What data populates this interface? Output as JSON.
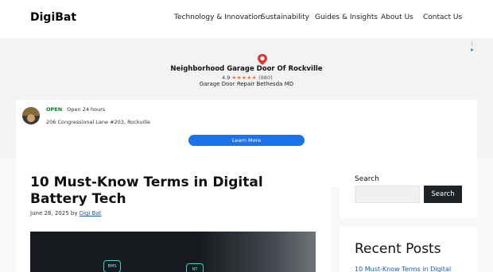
{
  "site": {
    "logo": "DigiBat",
    "nav": [
      {
        "label": "Technology & Innovation"
      },
      {
        "label": "Sustainability"
      },
      {
        "label": "Guides & Insights"
      },
      {
        "label": "About Us"
      },
      {
        "label": "Contact Us"
      }
    ]
  },
  "ad": {
    "business_name": "Neighborhood Garage Door Of Rockville",
    "rating": "4.9",
    "stars": "★★★★★",
    "review_count": "(980)",
    "subtitle": "Garage Door Repair Bethesda MD",
    "status": "OPEN",
    "hours": "Open 24 hours",
    "address": "206 Congressional Lane #203, Rockville",
    "cta": "Learn More",
    "pin_icon": "map-pin-icon",
    "accent_color": "#1a73e8",
    "open_color": "#0a7a2a"
  },
  "article": {
    "title": "10 Must-Know Terms in Digital Battery Tech",
    "date": "June 28, 2025",
    "by": "by",
    "author": "Digi Bat",
    "image_labels": [
      "BMS",
      "NT"
    ]
  },
  "sidebar": {
    "search_label": "Search",
    "search_placeholder": "",
    "search_button": "Search",
    "recent_title": "Recent Posts",
    "recent_posts": [
      "10 Must-Know Terms in Digital"
    ]
  }
}
